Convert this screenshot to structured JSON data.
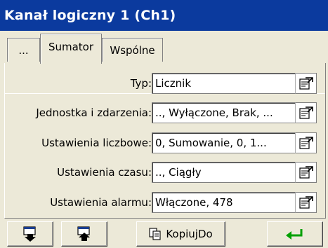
{
  "window": {
    "title": "Kanał logiczny 1 (Ch1)"
  },
  "tabs": [
    {
      "label": "...",
      "active": false
    },
    {
      "label": "Sumator",
      "active": true
    },
    {
      "label": "Wspólne",
      "active": false
    }
  ],
  "fields": [
    {
      "label": "Typ:",
      "value": "Licznik"
    },
    {
      "label": "Jednostka i zdarzenia:",
      "value": ".., Wyłączone, Brak, ..."
    },
    {
      "label": "Ustawienia liczbowe:",
      "value": "0, Sumowanie, 0, 1..."
    },
    {
      "label": "Ustawienia czasu:",
      "value": ".., Ciągły"
    },
    {
      "label": "Ustawienia alarmu:",
      "value": "Włączone, 478"
    }
  ],
  "toolbar": {
    "copy_label": "KopiujDo"
  },
  "icons": {
    "field_button": "edit-dialog-icon",
    "down": "move-down-icon",
    "up": "move-up-icon",
    "copy": "copy-icon",
    "enter": "enter-icon"
  },
  "colors": {
    "titlebar": "#0b3a9e",
    "background": "#ece9d8",
    "enter_arrow": "#00a000"
  }
}
